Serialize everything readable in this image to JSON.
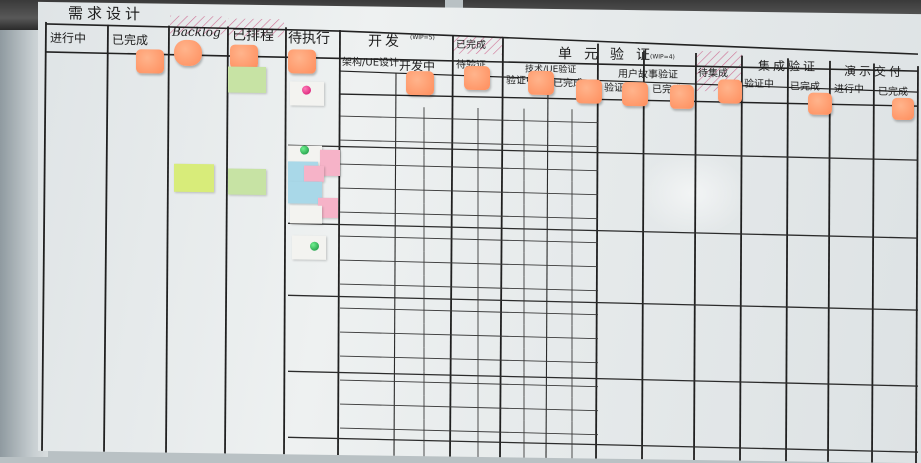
{
  "headers": {
    "demand_design": "需求设计",
    "in_progress_1": "进行中",
    "done_1": "已完成",
    "backlog": "Backlog",
    "scheduled": "已排程",
    "pending": "待执行",
    "develop": "开发",
    "wip_note": "(WIP=5)",
    "dev_ue_design": "架构/UE设计",
    "dev_in_progress": "开发中",
    "done_dev": "已完成",
    "to_verify": "待验证",
    "unit_verify": "单元验证",
    "unit_verify_note": "(WIP=4)",
    "tech_ue_verify": "技术/UE验证",
    "verify_sub": "验证中",
    "done_sub": "已完成",
    "user_story_verify": "用户故事验证",
    "usv_in_progress": "验证中",
    "usv_done": "已完成",
    "waiting_integration": "待集成",
    "integration_verify": "集成验证",
    "iv_in_progress": "验证中",
    "iv_done": "已完成",
    "demo_delivery": "演示交付",
    "dd_in_progress": "进行中",
    "dd_done": "已完成"
  },
  "colors": {
    "board": "#e6eaeb",
    "line": "#1f1f1f",
    "orange_note": "#ff9366",
    "green_magnet": "#17b14a",
    "pink_magnet": "#e8187a"
  }
}
